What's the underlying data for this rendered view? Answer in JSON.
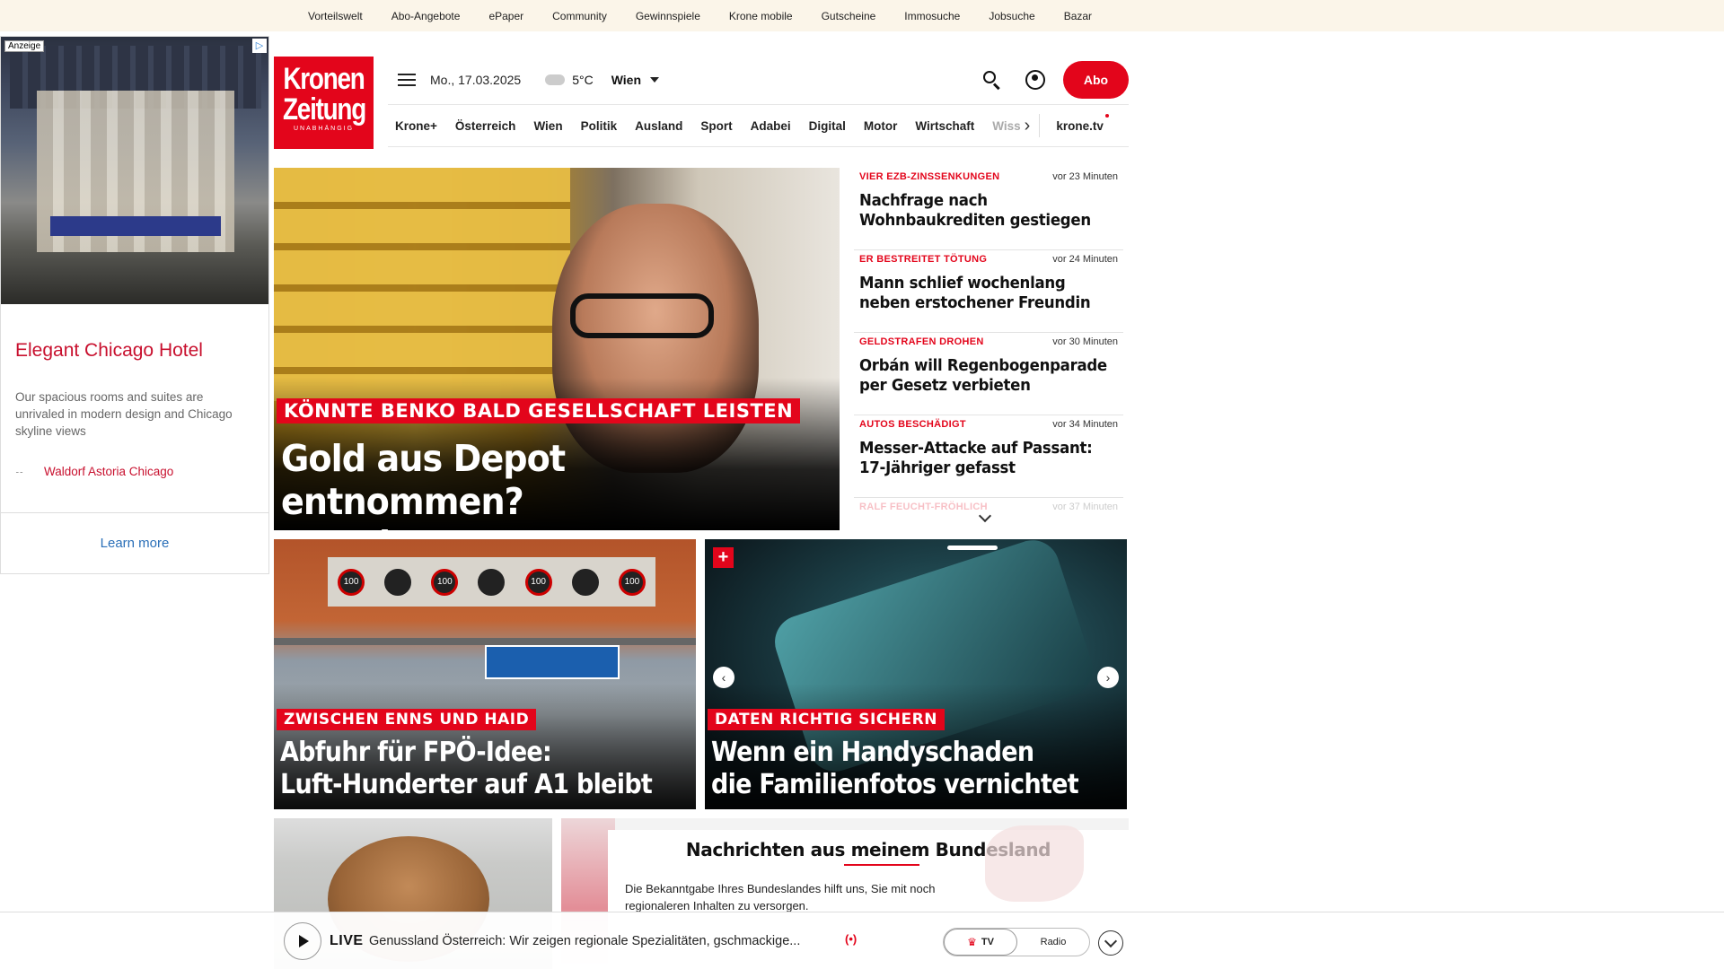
{
  "topbar": {
    "links": [
      "Vorteilswelt",
      "Abo-Angebote",
      "ePaper",
      "Community",
      "Gewinnspiele",
      "Krone mobile",
      "Gutscheine",
      "Immosuche",
      "Jobsuche",
      "Bazar"
    ]
  },
  "ad": {
    "label": "Anzeige",
    "title": "Elegant Chicago Hotel",
    "description": "Our spacious rooms and suites are unrivaled in modern design and Chicago skyline views",
    "brand": "Waldorf Astoria Chicago",
    "cta": "Learn more"
  },
  "logo": {
    "line1": "Kronen",
    "line2": "Zeitung",
    "tagline": "UNABHÄNGIG"
  },
  "header": {
    "date": "Mo., 17.03.2025",
    "temperature": "5°C",
    "city": "Wien",
    "abo_label": "Abo"
  },
  "nav": {
    "items": [
      "Krone+",
      "Österreich",
      "Wien",
      "Politik",
      "Ausland",
      "Sport",
      "Adabei",
      "Digital",
      "Motor",
      "Wirtschaft"
    ],
    "faded": "Wiss",
    "tv": "krone.tv"
  },
  "hero": {
    "kicker": "KÖNNTE BENKO BALD GESELLSCHAFT LEISTEN",
    "headline_line1": "Gold aus Depot entnommen?",
    "headline_line2": "Promi-Investor festgenommen"
  },
  "news": [
    {
      "category": "VIER EZB-ZINSSENKUNGEN",
      "time": "vor 23 Minuten",
      "title": "Nachfrage nach Wohnbaukrediten gestiegen"
    },
    {
      "category": "ER BESTREITET TÖTUNG",
      "time": "vor 24 Minuten",
      "title": "Mann schlief wochenlang neben erstochener Freundin"
    },
    {
      "category": "GELDSTRAFEN DROHEN",
      "time": "vor 30 Minuten",
      "title": "Orbán will Regenbogenparade per Gesetz verbieten"
    },
    {
      "category": "AUTOS BESCHÄDIGT",
      "time": "vor 34 Minuten",
      "title": "Messer-Attacke auf Passant: 17-Jähriger gefasst"
    },
    {
      "category": "RALF FEUCHT-FRÖHLICH",
      "time": "vor 37 Minuten",
      "title": ""
    }
  ],
  "card_a": {
    "kicker": "ZWISCHEN ENNS UND HAID",
    "headline_line1": "Abfuhr für FPÖ-Idee:",
    "headline_line2": "Luft-Hunderter auf A1 bleibt",
    "sign_value": "100"
  },
  "card_b": {
    "kicker": "DATEN RICHTIG SICHERN",
    "headline_line1": "Wenn ein Handyschaden",
    "headline_line2": "die Familienfotos vernichtet"
  },
  "modal": {
    "title": "Nachrichten aus meinem Bundesland",
    "text": "Die Bekanntgabe Ihres Bundeslandes hilft uns, Sie mit noch regionaleren Inhalten zu versorgen."
  },
  "live": {
    "label": "LIVE",
    "text": "Genussland Österreich: Wir zeigen regionale Spezialitäten, gschmackige...",
    "tv": "TV",
    "radio": "Radio"
  }
}
